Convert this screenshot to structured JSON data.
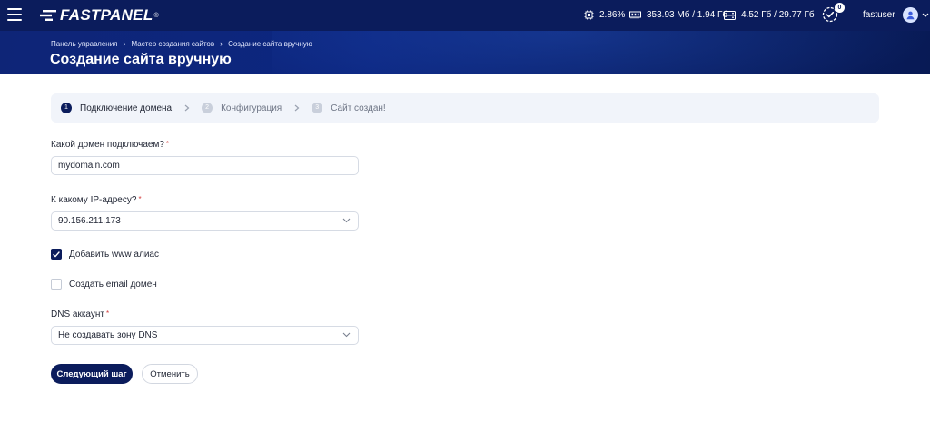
{
  "topbar": {
    "logo_text": "FASTPANEL",
    "logo_reg": "®",
    "cpu": "2.86%",
    "ram": "353.93 Мб / 1.94 Гб",
    "disk": "4.52 Гб / 29.77 Гб",
    "tasks_count": "0",
    "username": "fastuser"
  },
  "header": {
    "breadcrumbs": [
      "Панель управления",
      "Мастер создания сайтов",
      "Создание сайта вручную"
    ],
    "title": "Создание сайта вручную"
  },
  "steps": [
    {
      "num": "1",
      "label": "Подключение домена",
      "state": "active"
    },
    {
      "num": "2",
      "label": "Конфигурация",
      "state": "inactive"
    },
    {
      "num": "3",
      "label": "Сайт создан!",
      "state": "inactive"
    }
  ],
  "form": {
    "domain_label": "Какой домен подключаем?",
    "domain_value": "mydomain.com",
    "ip_label": "К какому IP-адресу?",
    "ip_value": "90.156.211.173",
    "www_alias_label": "Добавить www алиас",
    "www_alias_checked": true,
    "email_domain_label": "Создать email домен",
    "email_domain_checked": false,
    "dns_label": "DNS аккаунт",
    "dns_value": "Не создавать зону DNS",
    "required_mark": "*"
  },
  "buttons": {
    "next": "Следующий шаг",
    "cancel": "Отменить"
  },
  "colors": {
    "brand_navy": "#0b1c5c",
    "required_red": "#d23a3a"
  }
}
